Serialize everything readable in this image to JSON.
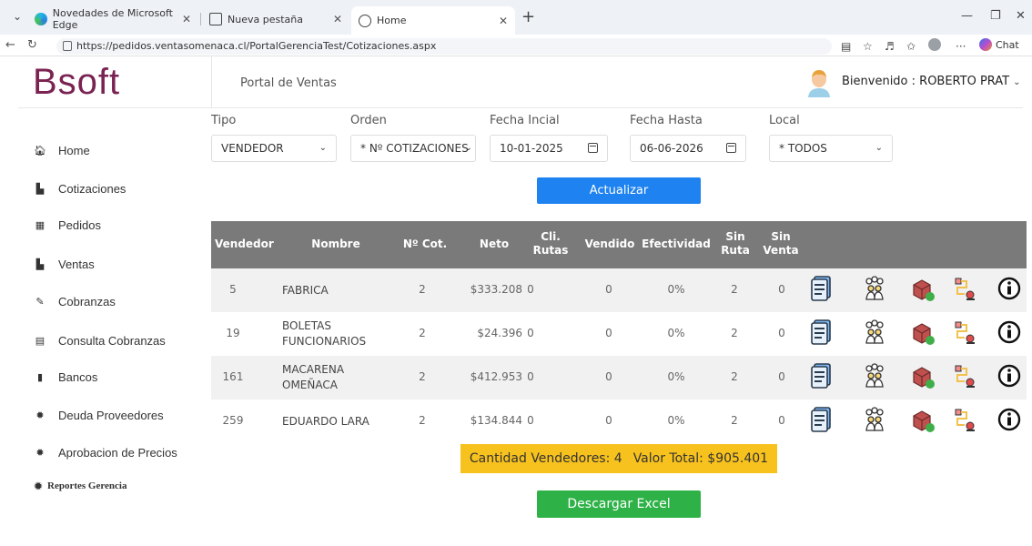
{
  "browser": {
    "tabs": [
      {
        "label": "Novedades de Microsoft Edge"
      },
      {
        "label": "Nueva pestaña"
      },
      {
        "label": "Home"
      }
    ],
    "url": "https://pedidos.ventasomenaca.cl/PortalGerenciaTest/Cotizaciones.aspx",
    "chat_label": "Chat"
  },
  "header": {
    "logo_text": "Bsoft",
    "portal_title": "Portal de Ventas",
    "welcome": "Bienvenido : ROBERTO PRAT"
  },
  "sidebar": {
    "items": [
      {
        "label": "Home",
        "icon": "home-icon"
      },
      {
        "label": "Cotizaciones",
        "icon": "file-icon"
      },
      {
        "label": "Pedidos",
        "icon": "calendar-icon"
      },
      {
        "label": "Ventas",
        "icon": "file-icon"
      },
      {
        "label": "Cobranzas",
        "icon": "edit-icon"
      },
      {
        "label": "Consulta Cobranzas",
        "icon": "list-icon"
      },
      {
        "label": "Bancos",
        "icon": "bookmark-icon"
      },
      {
        "label": "Deuda Proveedores",
        "icon": "gear-icon"
      },
      {
        "label": "Aprobacion de Precios",
        "icon": "gear-icon"
      },
      {
        "label": "Reportes Gerencia",
        "icon": "gear-icon"
      }
    ]
  },
  "filters": {
    "tipo": {
      "label": "Tipo",
      "value": "VENDEDOR"
    },
    "orden": {
      "label": "Orden",
      "value": "* Nº COTIZACIONES"
    },
    "fecha_inicial": {
      "label": "Fecha Incial",
      "value": "10-01-2025"
    },
    "fecha_hasta": {
      "label": "Fecha Hasta",
      "value": "06-06-2026"
    },
    "local": {
      "label": "Local",
      "value": "* TODOS"
    }
  },
  "actions": {
    "actualizar": "Actualizar",
    "descargar": "Descargar Excel"
  },
  "table": {
    "headers": {
      "vendedor": "Vendedor",
      "nombre": "Nombre",
      "ncot": "Nº Cot.",
      "neto": "Neto",
      "cli_rutas_1": "Cli.",
      "cli_rutas_2": "Rutas",
      "vendido": "Vendido",
      "efectividad": "Efectividad",
      "sin_ruta_1": "Sin",
      "sin_ruta_2": "Ruta",
      "sin_venta_1": "Sin",
      "sin_venta_2": "Venta"
    },
    "rows": [
      {
        "vendedor": "5",
        "nombre1": "FABRICA",
        "nombre2": "",
        "ncot": "2",
        "neto": "$333.208",
        "cli": "0",
        "vendido": "0",
        "efectividad": "0%",
        "sin_ruta": "2",
        "sin_venta": "0"
      },
      {
        "vendedor": "19",
        "nombre1": "BOLETAS",
        "nombre2": "FUNCIONARIOS",
        "ncot": "2",
        "neto": "$24.396",
        "cli": "0",
        "vendido": "0",
        "efectividad": "0%",
        "sin_ruta": "2",
        "sin_venta": "0"
      },
      {
        "vendedor": "161",
        "nombre1": "MACARENA",
        "nombre2": "OMEÑACA",
        "ncot": "2",
        "neto": "$412.953",
        "cli": "0",
        "vendido": "0",
        "efectividad": "0%",
        "sin_ruta": "2",
        "sin_venta": "0"
      },
      {
        "vendedor": "259",
        "nombre1": "EDUARDO LARA",
        "nombre2": "",
        "ncot": "2",
        "neto": "$134.844",
        "cli": "0",
        "vendido": "0",
        "efectividad": "0%",
        "sin_ruta": "2",
        "sin_venta": "0"
      }
    ]
  },
  "summary": {
    "cantidad": "Cantidad Vendedores: 4",
    "valor": "Valor Total: $905.401"
  },
  "colors": {
    "accent_blue": "#1e82f0",
    "excel_green": "#2eb247",
    "summary_yellow": "#f8c21e",
    "table_header": "#7a7a7a",
    "logo": "#7a2352"
  }
}
